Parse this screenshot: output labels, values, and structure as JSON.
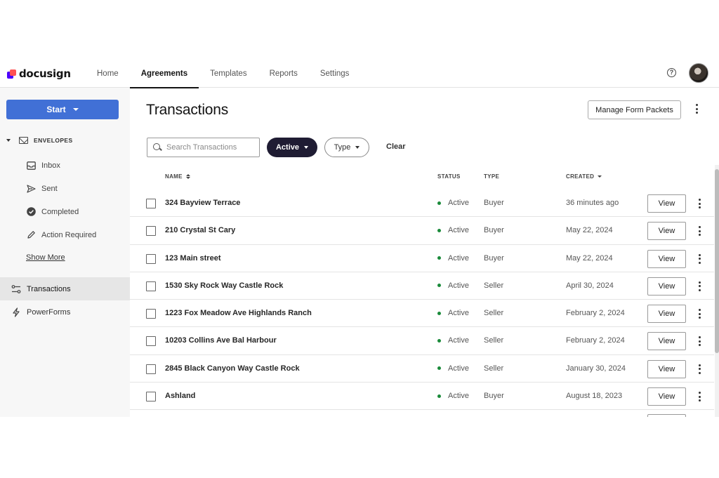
{
  "brand": {
    "name": "docusign",
    "colors": {
      "accent": "#4170d6",
      "logo_primary": "#4c00ff",
      "logo_secondary": "#ff5252",
      "active_pill": "#1f1c33",
      "status_active": "#1a8a3a"
    }
  },
  "nav": {
    "tabs": [
      {
        "label": "Home"
      },
      {
        "label": "Agreements",
        "active": true
      },
      {
        "label": "Templates"
      },
      {
        "label": "Reports"
      },
      {
        "label": "Settings"
      }
    ],
    "help_icon": "help-circle-icon",
    "help_glyph": "?",
    "avatar": "user-avatar"
  },
  "sidebar": {
    "start_label": "Start",
    "envelopes_label": "ENVELOPES",
    "envelope_items": [
      {
        "label": "Inbox",
        "icon": "inbox-icon"
      },
      {
        "label": "Sent",
        "icon": "send-icon"
      },
      {
        "label": "Completed",
        "icon": "check-circle-icon"
      },
      {
        "label": "Action Required",
        "icon": "pen-icon"
      }
    ],
    "show_more_label": "Show More",
    "main_items": [
      {
        "label": "Transactions",
        "icon": "transactions-icon",
        "active": true
      },
      {
        "label": "PowerForms",
        "icon": "lightning-icon"
      }
    ]
  },
  "main": {
    "title": "Transactions",
    "manage_button_label": "Manage Form Packets",
    "search": {
      "placeholder": "Search Transactions",
      "value": ""
    },
    "filters": {
      "active_label": "Active",
      "type_label": "Type",
      "clear_label": "Clear"
    },
    "columns": {
      "name": "NAME",
      "status": "STATUS",
      "type": "TYPE",
      "created": "CREATED"
    },
    "view_label": "View",
    "rows": [
      {
        "name": "324 Bayview Terrace",
        "status": "Active",
        "type": "Buyer",
        "created": "36 minutes ago"
      },
      {
        "name": "210 Crystal St Cary",
        "status": "Active",
        "type": "Buyer",
        "created": "May 22, 2024"
      },
      {
        "name": "123 Main street",
        "status": "Active",
        "type": "Buyer",
        "created": "May 22, 2024"
      },
      {
        "name": "1530 Sky Rock Way Castle Rock",
        "status": "Active",
        "type": "Seller",
        "created": "April 30, 2024"
      },
      {
        "name": "1223 Fox Meadow Ave Highlands Ranch",
        "status": "Active",
        "type": "Seller",
        "created": "February 2, 2024"
      },
      {
        "name": "10203 Collins Ave Bal Harbour",
        "status": "Active",
        "type": "Seller",
        "created": "February 2, 2024"
      },
      {
        "name": "2845 Black Canyon Way Castle Rock",
        "status": "Active",
        "type": "Seller",
        "created": "January 30, 2024"
      },
      {
        "name": "Ashland",
        "status": "Active",
        "type": "Buyer",
        "created": "August 18, 2023"
      }
    ]
  }
}
